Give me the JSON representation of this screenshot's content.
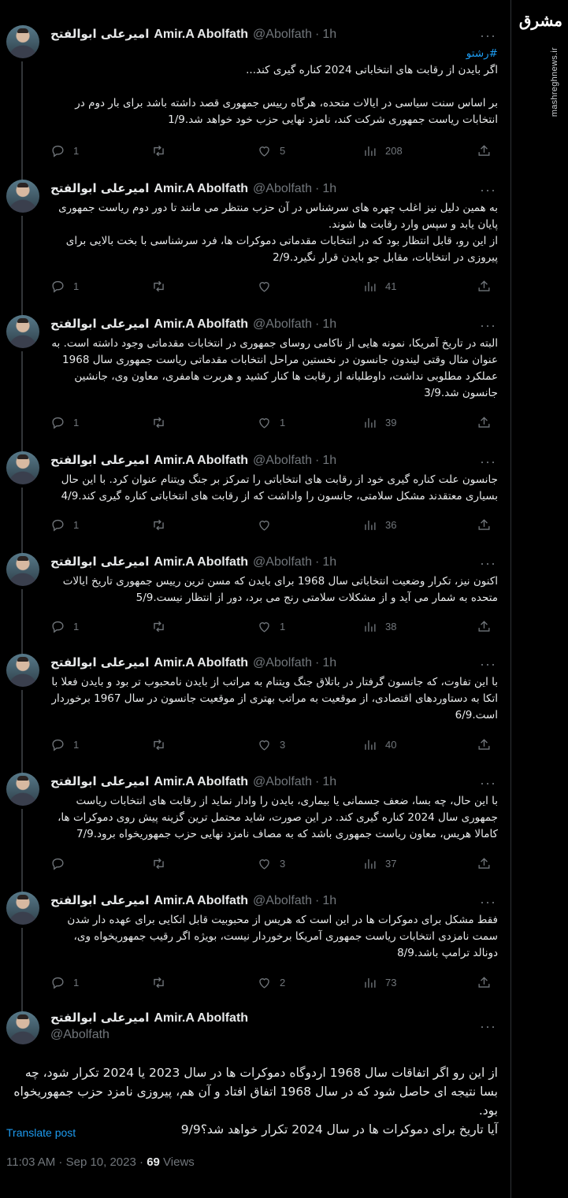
{
  "brand": {
    "logo_text": "مشرق",
    "watermark": "mashreghnews.ir"
  },
  "author": {
    "name_fa": "امیرعلی ابوالفتح",
    "name_en": "Amir.A Abolfath",
    "handle": "@Abolfath"
  },
  "more_glyph": "···",
  "tweets": [
    {
      "time": "1h",
      "hashtag": "#رشتو",
      "text": "اگر بایدن از رقابت های انتخاباتی 2024 کناره گیری کند...\n\nبر اساس سنت سیاسی در ایالات متحده، هرگاه رییس جمهوری قصد داشته باشد برای بار دوم در انتخابات ریاست جمهوری شرکت کند، نامزد نهایی حزب خود خواهد شد.1/9",
      "replies": "1",
      "retweets": "",
      "likes": "5",
      "views": "208"
    },
    {
      "time": "1h",
      "text": "به همین دلیل نیز اغلب چهره های سرشناس در آن حزب منتظر می مانند تا دور دوم ریاست جمهوری پایان یابد و سپس وارد رقابت ها شوند.\nاز این رو، قابل انتظار بود که در انتخابات مقدماتی دموکرات ها، فرد سرشناسی با بخت بالایی برای پیروزی در انتخابات، مقابل جو بایدن قرار نگیرد.2/9",
      "replies": "1",
      "retweets": "",
      "likes": "",
      "views": "41"
    },
    {
      "time": "1h",
      "text": "البته در تاریخ آمریکا، نمونه هایی از ناکامی روسای جمهوری در انتخابات مقدماتی وجود داشته است. به عنوان مثال وقتی لیندون جانسون در نخستین مراحل انتخابات مقدماتی ریاست جمهوری سال 1968 عملکرد مطلوبی نداشت، داوطلبانه از رقابت ها کنار کشید و هربرت هامفری، معاون وی، جانشین جانسون شد.3/9",
      "replies": "1",
      "retweets": "",
      "likes": "1",
      "views": "39"
    },
    {
      "time": "1h",
      "text": "جانسون علت کناره گیری خود از رقابت های انتخاباتی را تمرکز بر جنگ ویتنام عنوان کرد. با این حال بسیاری معتقدند مشکل سلامتی، جانسون را واداشت که از رقابت های انتخاباتی کناره گیری کند.4/9",
      "replies": "1",
      "retweets": "",
      "likes": "",
      "views": "36"
    },
    {
      "time": "1h",
      "text": "اکنون نیز، تکرار وضعیت انتخاباتی سال 1968 برای بایدن که مسن ترین رییس جمهوری تاریخ ایالات متحده به شمار می آید و از مشکلات سلامتی رنج می برد، دور از انتظار نیست.5/9",
      "replies": "1",
      "retweets": "",
      "likes": "1",
      "views": "38"
    },
    {
      "time": "1h",
      "text": "با این تفاوت، که جانسون گرفتار در باتلاق جنگ ویتنام به مراتب از بایدن نامحبوب تر بود و بایدن فعلا با اتکا به دستاوردهای اقتصادی، از موقعیت به مراتب بهتری از موقعیت جانسون در سال 1967 برخوردار است.6/9",
      "replies": "1",
      "retweets": "",
      "likes": "3",
      "views": "40"
    },
    {
      "time": "1h",
      "text": "با این حال، چه بسا، ضعف جسمانی یا بیماری، بایدن را وادار نماید از رقابت های انتخابات ریاست جمهوری سال 2024 کناره گیری کند. در این صورت، شاید محتمل ترین گزینه پیش روی دموکرات ها، کامالا هریس، معاون ریاست جمهوری باشد که به مصاف نامزد نهایی حزب جمهوریخواه برود.7/9",
      "replies": "",
      "retweets": "",
      "likes": "3",
      "views": "37"
    },
    {
      "time": "1h",
      "text": "فقط مشکل برای دموکرات ها در این است که هریس از محبوبیت قابل اتکایی برای عهده دار شدن سمت نامزدی انتخابات ریاست جمهوری آمریکا برخوردار نیست، بویژه اگر رقیب جمهوریخواه وی، دونالد ترامپ باشد.8/9",
      "replies": "1",
      "retweets": "",
      "likes": "2",
      "views": "73"
    }
  ],
  "main_tweet": {
    "text": "از این رو اگر اتفاقات سال 1968 اردوگاه دموکرات ها در سال 2023 یا 2024 تکرار شود، چه بسا نتیجه ای حاصل شود که در سال 1968 اتفاق افتاد و آن هم، پیروزی نامزد حزب جمهوریخواه بود.\nآیا تاریخ برای دموکرات ها در سال 2024 تکرار خواهد شد؟9/9",
    "translate_label": "Translate post",
    "timestamp": "11:03 AM · Sep 10, 2023",
    "separator": " · ",
    "views_count": "69",
    "views_label": " Views"
  }
}
